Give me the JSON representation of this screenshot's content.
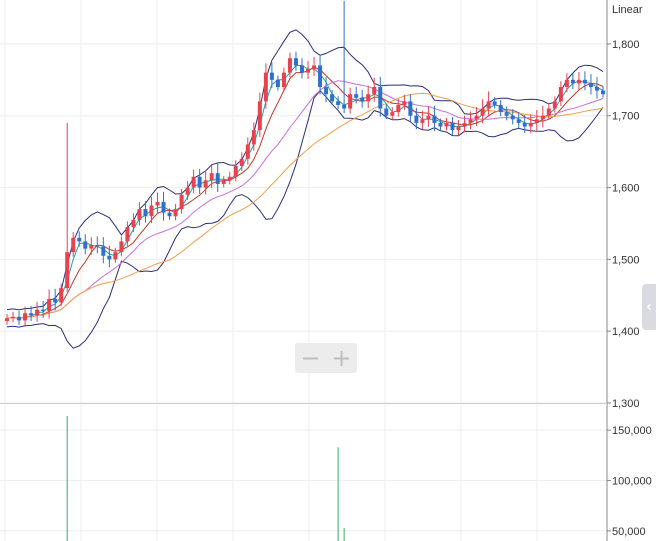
{
  "scale_label": "Linear",
  "colors": {
    "up": "#e8414f",
    "down": "#2f6fcf",
    "ma_short": "#27a0a0",
    "ma_mid": "#c0392b",
    "ma_long": "#c76fe0",
    "ma_longer": "#f0a04b",
    "bollinger": "#2b2f7a",
    "volume": "#3aaa6a",
    "grid": "#eeeeee"
  },
  "chart_data": [
    {
      "type": "candlestick",
      "scale": "linear",
      "ylim": [
        1300,
        1850
      ],
      "y_ticks": [
        "1,800",
        "1,700",
        "1,600",
        "1,500",
        "1,400",
        "1,300"
      ],
      "y_tick_values": [
        1800,
        1700,
        1600,
        1500,
        1400,
        1300
      ],
      "close_approx": [
        1418,
        1420,
        1415,
        1425,
        1422,
        1430,
        1428,
        1445,
        1440,
        1460,
        1510,
        1530,
        1525,
        1515,
        1520,
        1518,
        1505,
        1500,
        1510,
        1525,
        1545,
        1555,
        1570,
        1560,
        1575,
        1580,
        1565,
        1560,
        1570,
        1590,
        1600,
        1615,
        1600,
        1610,
        1620,
        1605,
        1610,
        1615,
        1630,
        1640,
        1660,
        1680,
        1720,
        1760,
        1750,
        1740,
        1760,
        1780,
        1770,
        1760,
        1765,
        1770,
        1740,
        1730,
        1720,
        1715,
        1710,
        1730,
        1725,
        1720,
        1730,
        1740,
        1710,
        1700,
        1705,
        1715,
        1720,
        1700,
        1690,
        1695,
        1700,
        1690,
        1685,
        1690,
        1680,
        1685,
        1690,
        1695,
        1700,
        1710,
        1720,
        1715,
        1705,
        1700,
        1695,
        1690,
        1685,
        1690,
        1695,
        1700,
        1710,
        1720,
        1740,
        1750,
        1745,
        1750,
        1745,
        1740,
        1735,
        1730
      ]
    },
    {
      "type": "bar",
      "name": "volume",
      "ylim": [
        40000,
        170000
      ],
      "y_ticks": [
        "150,000",
        "100,000",
        "50,000"
      ],
      "y_tick_values": [
        150000,
        100000,
        50000
      ],
      "spikes": [
        {
          "index": 10,
          "value": 164000
        },
        {
          "index": 55,
          "value": 133000
        },
        {
          "index": 56,
          "value": 53000
        }
      ]
    }
  ]
}
